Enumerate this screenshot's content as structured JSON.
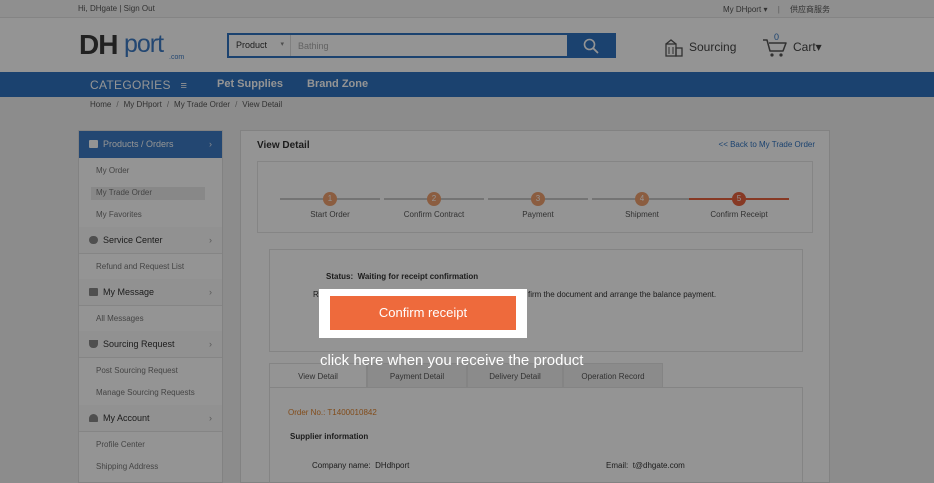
{
  "topbar": {
    "greeting": "Hi, DHgate",
    "separator": "|",
    "sign_out": "Sign Out",
    "my_dhport": "My DHport",
    "my_dhport_arrow": "▾",
    "supplier_service": "供应商服务"
  },
  "header": {
    "logo_dh": "DH",
    "logo_port": "port",
    "logo_com": ".com",
    "search_scope": "Product",
    "search_scope_arrow": "▾",
    "search_placeholder": "Bathing",
    "sourcing_label": "Sourcing",
    "cart_count": "0",
    "cart_label": "Cart",
    "cart_arrow": "▾"
  },
  "nav": {
    "categories": "CATEGORIES",
    "menu_glyph": "≡",
    "links": [
      "Pet Supplies",
      "Brand Zone"
    ]
  },
  "breadcrumb": {
    "items": [
      "Home",
      "My DHport",
      "My Trade Order",
      "View Detail"
    ],
    "separator": "/"
  },
  "sidebar": {
    "chevron": "›",
    "sections": [
      {
        "title": "Products / Orders",
        "items": [
          "My Order",
          "My Trade Order",
          "My Favorites"
        ]
      },
      {
        "title": "Service Center",
        "items": [
          "Refund and Request List"
        ]
      },
      {
        "title": "My Message",
        "items": [
          "All Messages"
        ]
      },
      {
        "title": "Sourcing Request",
        "items": [
          "Post Sourcing Request",
          "Manage Sourcing Requests"
        ]
      },
      {
        "title": "My Account",
        "items": [
          "Profile Center",
          "Shipping Address"
        ]
      }
    ]
  },
  "main": {
    "title": "View Detail",
    "back_link": "<< Back to My Trade Order",
    "steps": [
      {
        "num": "1",
        "label": "Start Order"
      },
      {
        "num": "2",
        "label": "Confirm Contract"
      },
      {
        "num": "3",
        "label": "Payment"
      },
      {
        "num": "4",
        "label": "Shipment"
      },
      {
        "num": "5",
        "label": "Confirm Receipt"
      }
    ],
    "status_label": "Status:",
    "status_value": "Waiting for receipt confirmation",
    "remark_label": "R",
    "remark_text": "firm the document and arrange the balance payment.",
    "tabs": [
      "View Detail",
      "Payment Detail",
      "Delivery Detail",
      "Operation Record"
    ],
    "order_no": "Order No.: T1400010842",
    "supplier_info": "Supplier information",
    "company_label": "Company name:",
    "company_value": "DHdhport",
    "email_label": "Email:",
    "email_value": "t@dhgate.com"
  },
  "overlay": {
    "confirm_button": "Confirm receipt",
    "hint": "click here when you receive the product"
  },
  "colors": {
    "brand_blue": "#2f73c0",
    "accent_orange": "#ee6a3c"
  }
}
